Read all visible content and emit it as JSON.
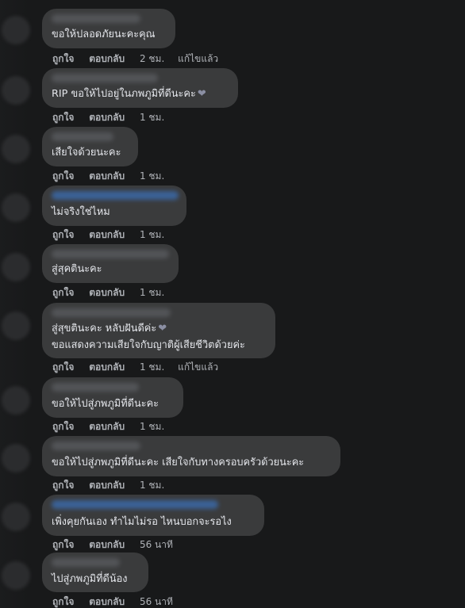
{
  "comments": [
    {
      "text": "ขอให้ปลอดภัยนะคะคุณ",
      "text2": "",
      "heart": false,
      "like": "ถูกใจ",
      "reply": "ตอบกลับ",
      "time": "2 ชม.",
      "edited": "แก้ไขแล้ว"
    },
    {
      "text": "RIP ขอให้ไปอยู่ในภพภูมิที่ดีนะคะ",
      "text2": "",
      "heart": true,
      "like": "ถูกใจ",
      "reply": "ตอบกลับ",
      "time": "1 ชม.",
      "edited": ""
    },
    {
      "text": "เสียใจด้วยนะคะ",
      "text2": "",
      "heart": false,
      "like": "ถูกใจ",
      "reply": "ตอบกลับ",
      "time": "1 ชม.",
      "edited": ""
    },
    {
      "text": "ไม่จริงใช่ไหม",
      "text2": "",
      "heart": false,
      "like": "ถูกใจ",
      "reply": "ตอบกลับ",
      "time": "1 ชม.",
      "edited": ""
    },
    {
      "text": "สู่สุคตินะคะ",
      "text2": "",
      "heart": false,
      "like": "ถูกใจ",
      "reply": "ตอบกลับ",
      "time": "1 ชม.",
      "edited": ""
    },
    {
      "text": "สู่สุขตินะคะ หลับฝันดีค่ะ",
      "text2": "ขอแสดงความเสียใจกับญาติผู้เสียชีวิตด้วยค่ะ",
      "heart": true,
      "like": "ถูกใจ",
      "reply": "ตอบกลับ",
      "time": "1 ชม.",
      "edited": "แก้ไขแล้ว"
    },
    {
      "text": "ขอให้ไปสู่ภพภูมิที่ดีนะคะ",
      "text2": "",
      "heart": false,
      "like": "ถูกใจ",
      "reply": "ตอบกลับ",
      "time": "1 ชม.",
      "edited": ""
    },
    {
      "text": "ขอให้ไปสู่ภพภูมิที่ดีนะคะ เสียใจกับทางครอบครัวด้วยนะคะ",
      "text2": "",
      "heart": false,
      "like": "ถูกใจ",
      "reply": "ตอบกลับ",
      "time": "1 ชม.",
      "edited": ""
    },
    {
      "text": "เพิ่งคุยกันเอง ทำไมไม่รอ ไหนบอกจะรอไง",
      "text2": "",
      "heart": false,
      "like": "ถูกใจ",
      "reply": "ตอบกลับ",
      "time": "56 นาที",
      "edited": ""
    },
    {
      "text": "ไปสู่ภพภูมิที่ดีน้อง",
      "text2": "",
      "heart": false,
      "like": "ถูกใจ",
      "reply": "ตอบกลับ",
      "time": "56 นาที",
      "edited": ""
    }
  ],
  "icons": {
    "heart": "dark-heart-icon"
  },
  "colors": {
    "background": "#18191a",
    "bubble": "#3a3b3c",
    "text": "#e4e6eb",
    "meta_text": "#b0b3b8"
  }
}
